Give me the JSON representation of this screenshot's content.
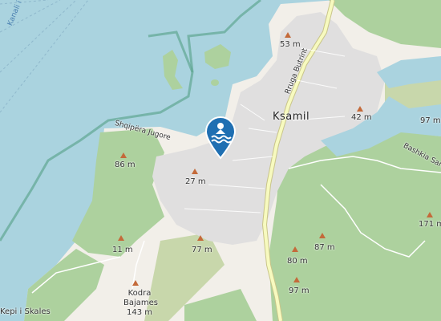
{
  "map": {
    "colors": {
      "water": "#aad3df",
      "forest": "#add19e",
      "scrub": "#c8d7ab",
      "urban": "#e0dfdf",
      "farmland": "#f2efe9",
      "boundary": "#5fa792",
      "road": "#f7fabf",
      "pin": "#1f6fb2"
    },
    "labels": {
      "town": "Ksamil",
      "road_main": "Rruga Butrint",
      "road_east": "Bashkia Sara",
      "channel": "Kanali i Liqenasit",
      "coast": "Shqipëra Jugore",
      "cape": "Kepi i Skales",
      "hill_name": "Kodra Bajames"
    },
    "peaks": {
      "p53": "53 m",
      "p42": "42 m",
      "p97a": "97 m",
      "p86": "86 m",
      "p27": "27 m",
      "p171": "171 m",
      "p11": "11 m",
      "p77": "77 m",
      "p87": "87 m",
      "p80": "80 m",
      "p97b": "97 m",
      "p143": "143 m"
    },
    "marker": {
      "icon": "swimming-icon"
    }
  }
}
